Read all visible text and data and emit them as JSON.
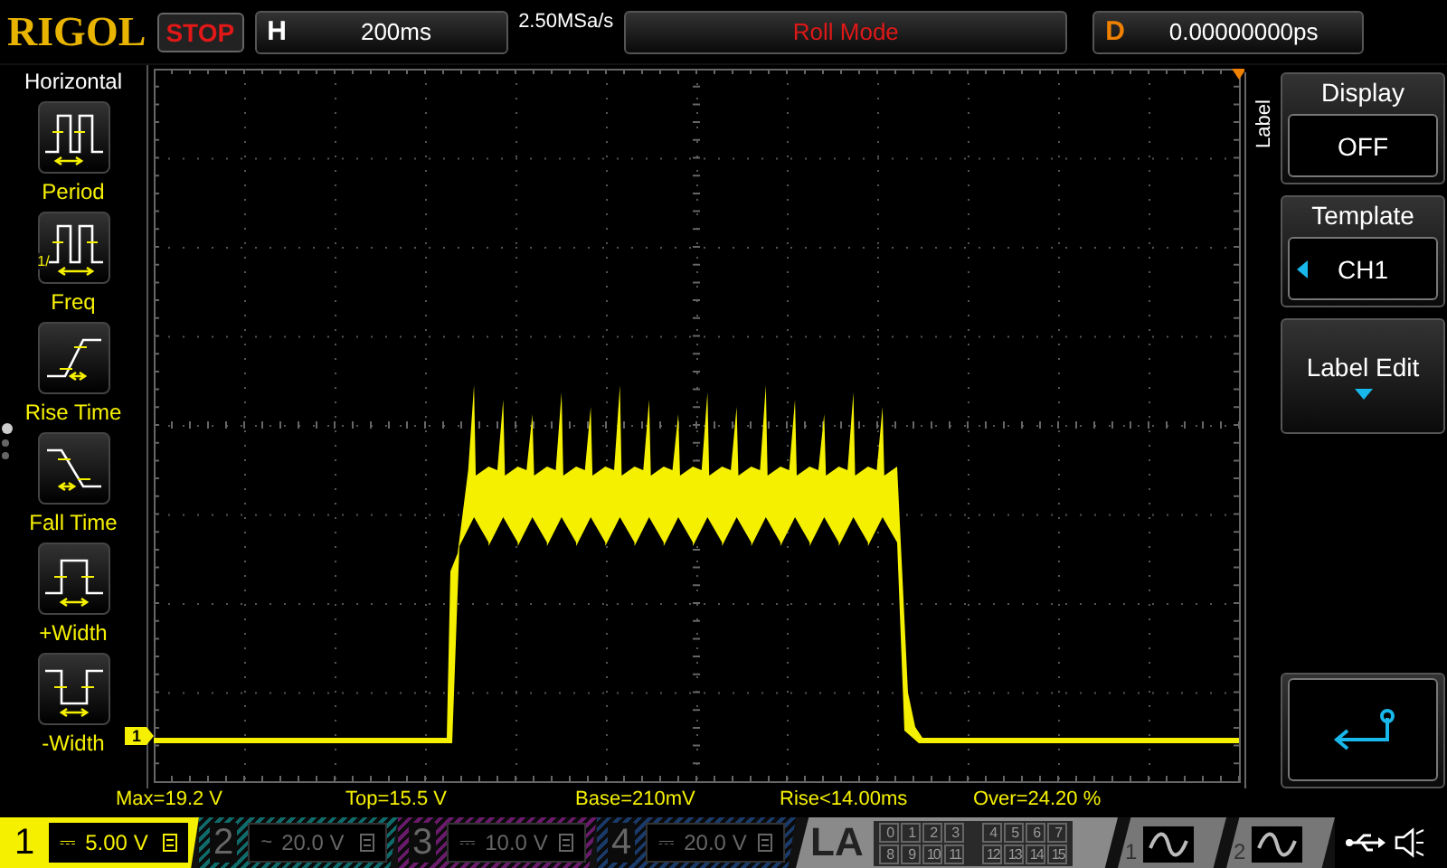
{
  "top_bar": {
    "brand": "RIGOL",
    "run_state": "STOP",
    "timebase_label": "H",
    "timebase": "200ms",
    "sample_rate": "2.50MSa/s",
    "mode": "Roll Mode",
    "delay_label": "D",
    "delay": "0.00000000ps"
  },
  "left_panel": {
    "title": "Horizontal",
    "pages": [
      {
        "selected": true
      },
      {
        "selected": false
      },
      {
        "selected": false
      }
    ],
    "items": [
      {
        "kind": "period",
        "label": "Period"
      },
      {
        "kind": "freq",
        "label": "Freq",
        "fraction": "1/"
      },
      {
        "kind": "rise",
        "label": "Rise Time"
      },
      {
        "kind": "fall",
        "label": "Fall Time"
      },
      {
        "kind": "pwidth",
        "label": "+Width"
      },
      {
        "kind": "nwidth",
        "label": "-Width"
      }
    ]
  },
  "display": {
    "channel_marker": "1"
  },
  "right_menu": {
    "tab": "Label",
    "items": [
      {
        "kind": "value",
        "title": "Display",
        "value": "OFF"
      },
      {
        "kind": "select",
        "title": "Template",
        "value": "CH1"
      },
      {
        "kind": "submenu",
        "title": "Label Edit"
      },
      {
        "kind": "back"
      }
    ]
  },
  "measurements": [
    "Max=19.2 V",
    "Top=15.5 V",
    "Base=210mV",
    "Rise<14.00ms",
    "Over=24.20 %"
  ],
  "channels": [
    {
      "label": "1",
      "coupling": "⎓",
      "scale": "5.00 V",
      "active": true,
      "color": "#f5f000"
    },
    {
      "label": "2",
      "coupling": "~",
      "scale": "20.0 V",
      "active": false,
      "color": "#0f6a6a"
    },
    {
      "label": "3",
      "coupling": "⎓",
      "scale": "10.0 V",
      "active": false,
      "color": "#6a1a6a"
    },
    {
      "label": "4",
      "coupling": "⎓",
      "scale": "20.0 V",
      "active": false,
      "color": "#1a3a6a"
    }
  ],
  "logic": {
    "label": "LA",
    "bits": [
      "0",
      "1",
      "2",
      "3",
      "4",
      "5",
      "6",
      "7",
      "8",
      "9",
      "10",
      "11",
      "12",
      "13",
      "14",
      "15"
    ]
  },
  "generators": [
    {
      "label": "1"
    },
    {
      "label": "2"
    }
  ]
}
